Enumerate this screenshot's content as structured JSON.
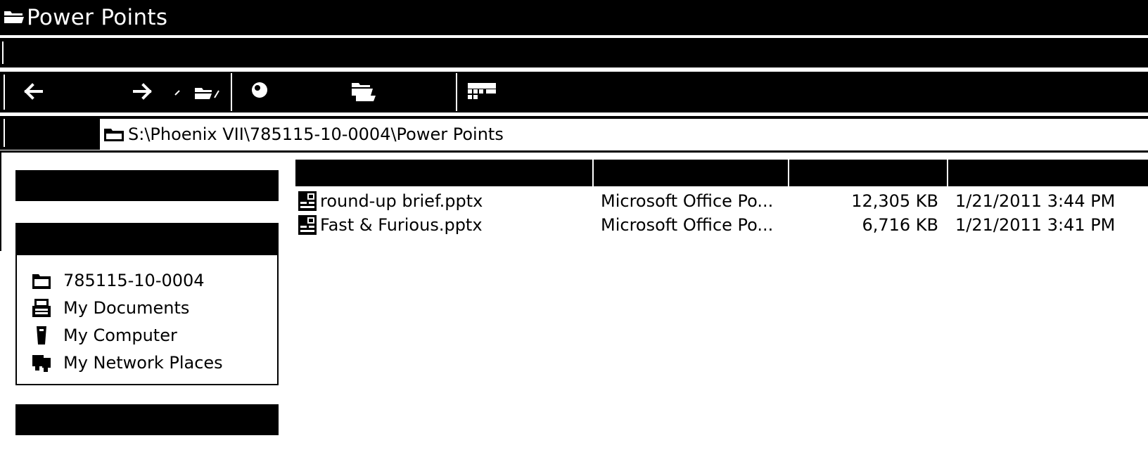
{
  "window": {
    "title": "Power Points",
    "title_icon": "open-folder-icon"
  },
  "toolbar": {
    "buttons": [
      {
        "name": "back-button",
        "icon": "arrow-left-icon"
      },
      {
        "name": "forward-button",
        "icon": "arrow-right-icon"
      },
      {
        "name": "up-folder-button",
        "icon": "folder-up-icon"
      },
      {
        "name": "search-button",
        "icon": "search-icon"
      },
      {
        "name": "folders-button",
        "icon": "folders-icon"
      },
      {
        "name": "views-button",
        "icon": "views-icon"
      }
    ]
  },
  "address": {
    "path": "S:\\Phoenix VII\\785115-10-0004\\Power Points",
    "icon": "folder-icon"
  },
  "other_places": {
    "items": [
      {
        "label": "785115-10-0004",
        "icon": "folder-icon"
      },
      {
        "label": "My Documents",
        "icon": "documents-icon"
      },
      {
        "label": "My Computer",
        "icon": "computer-icon"
      },
      {
        "label": "My Network Places",
        "icon": "network-icon"
      }
    ]
  },
  "files": [
    {
      "name": "round-up brief.pptx",
      "type": "Microsoft Office Po...",
      "size": "12,305 KB",
      "modified": "1/21/2011 3:44 PM",
      "icon": "pptx-file-icon"
    },
    {
      "name": "Fast & Furious.pptx",
      "type": "Microsoft Office Po...",
      "size": "6,716 KB",
      "modified": "1/21/2011 3:41 PM",
      "icon": "pptx-file-icon"
    }
  ],
  "colors": {
    "chrome": "#000000",
    "background": "#ffffff",
    "text": "#000000"
  }
}
